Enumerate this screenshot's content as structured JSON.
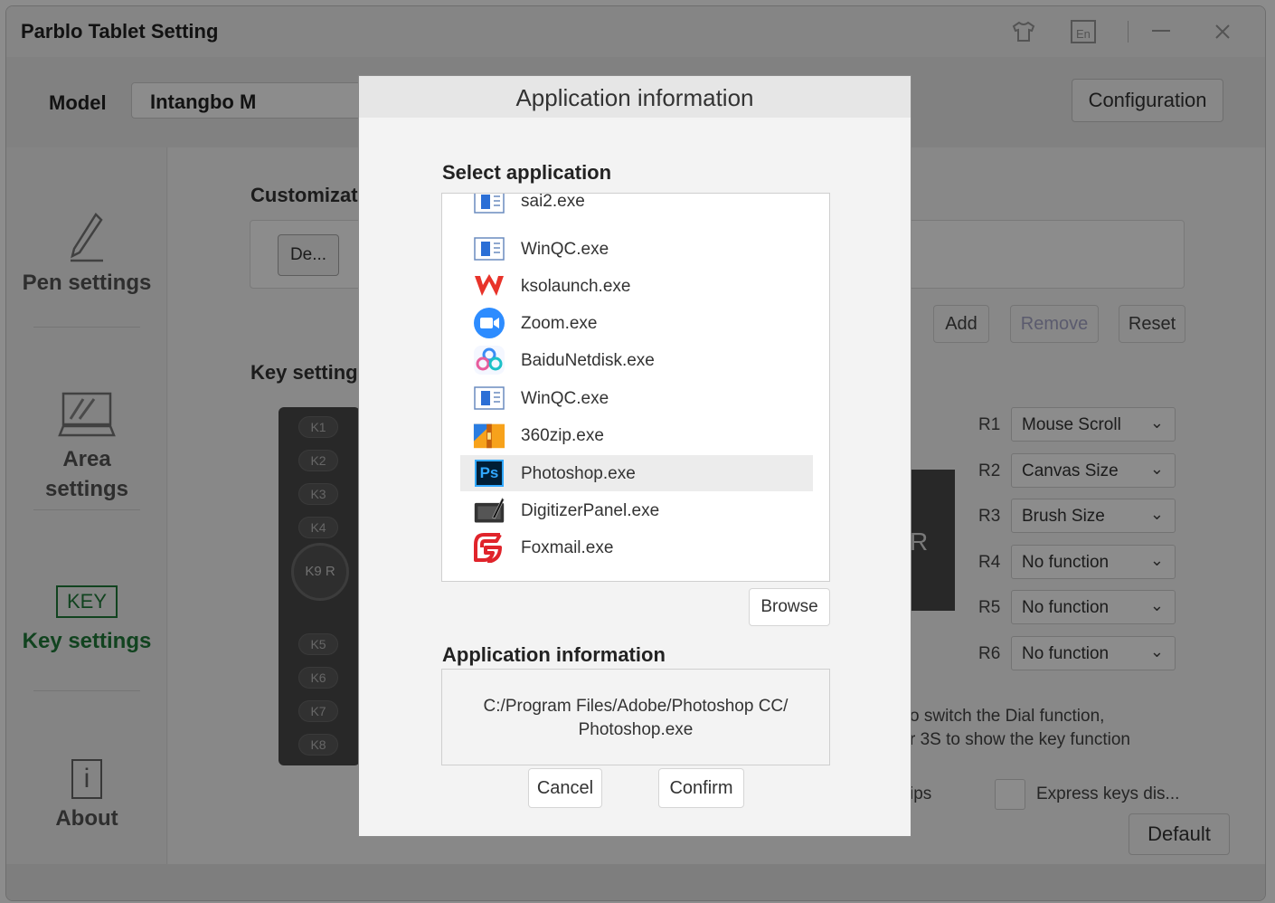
{
  "window": {
    "title": "Parblo Tablet Setting",
    "controls": [
      "skin-icon",
      "language-icon",
      "minimize-icon",
      "close-icon"
    ],
    "language_label": "En"
  },
  "header": {
    "model_label": "Model",
    "model_value": "Intangbo M",
    "configuration_label": "Configuration"
  },
  "sidebar": {
    "items": [
      {
        "label": "Pen settings",
        "icon": "pen-icon"
      },
      {
        "label_line1": "Area",
        "label_line2": "settings",
        "icon": "tablet-area-icon"
      },
      {
        "label": "Key settings",
        "icon": "key-icon",
        "icon_text": "KEY",
        "active": true
      },
      {
        "label": "About",
        "icon": "info-icon",
        "icon_text": "i"
      }
    ]
  },
  "main": {
    "customize_title": "Customizat",
    "default_app_label": "De...",
    "add_label": "Add",
    "remove_label": "Remove",
    "reset_label": "Reset",
    "key_setting_title": "Key setting",
    "tablet_keys": [
      "K1",
      "K2",
      "K3",
      "K4",
      "K9 R",
      "K5",
      "K6",
      "K7",
      "K8"
    ],
    "dial_letter": "R",
    "ring_rows": [
      {
        "label": "R1",
        "value": "Mouse Scroll"
      },
      {
        "label": "R2",
        "value": "Canvas Size"
      },
      {
        "label": "R3",
        "value": "Brush Size"
      },
      {
        "label": "R4",
        "value": "No function"
      },
      {
        "label": "R5",
        "value": "No function"
      },
      {
        "label": "R6",
        "value": "No function"
      }
    ],
    "hint_line1": "o switch the Dial function,",
    "hint_line2": "r 3S to show the key function",
    "tips_label": "ips",
    "express_keys_label": "Express keys dis...",
    "default_label": "Default"
  },
  "dialog": {
    "title": "Application information",
    "select_title": "Select application",
    "apps": [
      {
        "name": "sai2.exe",
        "icon": "sai-icon"
      },
      {
        "name": "WinQC.exe",
        "icon": "winqc-icon"
      },
      {
        "name": "ksolaunch.exe",
        "icon": "wps-icon"
      },
      {
        "name": "Zoom.exe",
        "icon": "zoom-icon"
      },
      {
        "name": "BaiduNetdisk.exe",
        "icon": "baidu-netdisk-icon"
      },
      {
        "name": "WinQC.exe",
        "icon": "winqc-icon"
      },
      {
        "name": "360zip.exe",
        "icon": "360zip-icon"
      },
      {
        "name": "Photoshop.exe",
        "icon": "photoshop-icon",
        "selected": true
      },
      {
        "name": "DigitizerPanel.exe",
        "icon": "digitizer-icon"
      },
      {
        "name": "Foxmail.exe",
        "icon": "foxmail-icon"
      }
    ],
    "ps_icon_text": "Ps",
    "browse_label": "Browse",
    "info_title": "Application information",
    "path_line1": "C:/Program Files/Adobe/Photoshop CC/",
    "path_line2": "Photoshop.exe",
    "cancel_label": "Cancel",
    "confirm_label": "Confirm"
  },
  "colors": {
    "active_green": "#1f7a3a",
    "overlay": "rgba(0,0,0,0.45)",
    "wps_red": "#e8332a",
    "zoom_blue": "#2d8cff",
    "ps_blue": "#001e36"
  }
}
